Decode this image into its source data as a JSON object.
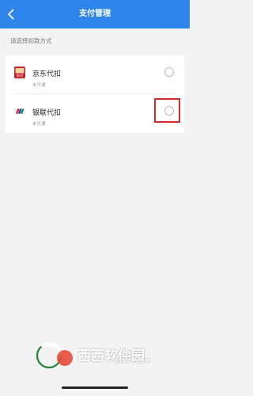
{
  "header": {
    "title": "支付管理"
  },
  "hint": "请选择扣款方式",
  "methods": [
    {
      "label": "京东代扣",
      "status": "未开通",
      "logo_text": "东付",
      "logo_icon": "jd-pay-icon",
      "selected": false
    },
    {
      "label": "银联代扣",
      "status": "未开通",
      "logo_text": "",
      "logo_icon": "unionpay-icon",
      "selected": false
    }
  ],
  "watermark": {
    "text": "西西软件园",
    "url": "CR173.COM"
  },
  "colors": {
    "header": "#2f86ea",
    "highlight": "#d62a2a",
    "background": "#f3f3f3"
  }
}
